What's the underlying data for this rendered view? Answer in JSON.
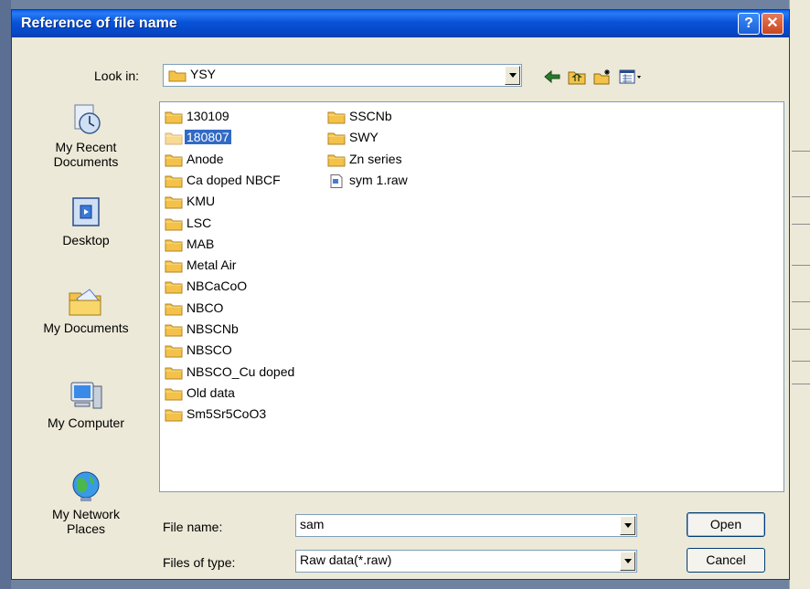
{
  "window": {
    "title": "Reference of file name",
    "help_glyph": "?",
    "close_glyph": "✕"
  },
  "look_in": {
    "label": "Look in:",
    "value": "YSY"
  },
  "places": [
    {
      "label": "My Recent Documents",
      "icon": "recent-documents-icon"
    },
    {
      "label": "Desktop",
      "icon": "desktop-icon"
    },
    {
      "label": "My Documents",
      "icon": "my-documents-icon"
    },
    {
      "label": "My Computer",
      "icon": "my-computer-icon"
    },
    {
      "label": "My Network Places",
      "icon": "network-places-icon"
    }
  ],
  "files_col1": [
    "130109",
    "180807",
    "Anode",
    "Ca doped NBCF",
    "KMU",
    "LSC",
    "MAB",
    "Metal Air",
    "NBCaCoO",
    "NBCO",
    "NBSCNb",
    "NBSCO",
    "NBSCO_Cu doped",
    "Old data",
    "Sm5Sr5CoO3"
  ],
  "files_col2": [
    "SSCNb",
    "SWY",
    "Zn series",
    "sym 1.raw"
  ],
  "selected_file": "180807",
  "file_name": {
    "label": "File name:",
    "value": "sam"
  },
  "file_type": {
    "label": "Files of type:",
    "value": "Raw data(*.raw)"
  },
  "buttons": {
    "open": "Open",
    "cancel": "Cancel"
  },
  "colors": {
    "titlebar": "#0852d8",
    "selection": "#316ac5",
    "folder": "#f4c24a"
  }
}
